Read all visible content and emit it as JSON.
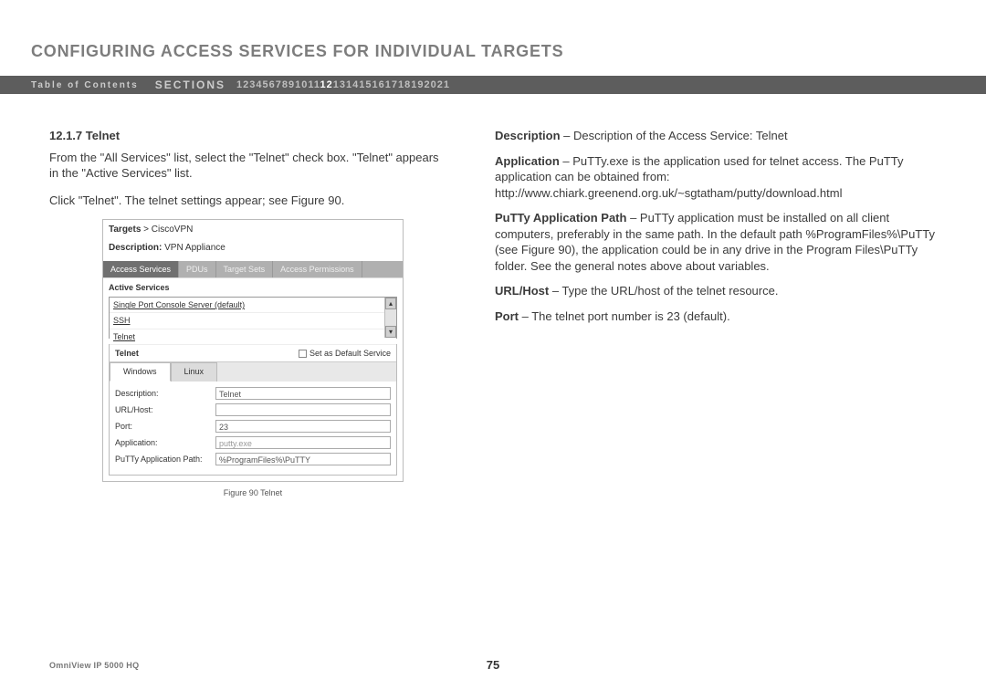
{
  "title": "CONFIGURING ACCESS SERVICES FOR INDIVIDUAL TARGETS",
  "nav": {
    "toc": "Table of Contents",
    "sections_label": "SECTIONS",
    "items": [
      "1",
      "2",
      "3",
      "4",
      "5",
      "6",
      "7",
      "8",
      "9",
      "10",
      "11",
      "12",
      "13",
      "14",
      "15",
      "16",
      "17",
      "18",
      "19",
      "20",
      "21"
    ],
    "active": "12"
  },
  "left": {
    "heading": "12.1.7 Telnet",
    "para1": "From the \"All Services\" list, select the \"Telnet\" check box. \"Telnet\" appears in the \"Active Services\" list.",
    "para2": "Click \"Telnet\". The telnet settings appear; see Figure 90."
  },
  "figure": {
    "breadcrumb_bold": "Targets",
    "breadcrumb_sep": " > ",
    "breadcrumb_tail": "CiscoVPN",
    "desc_label": "Description:",
    "desc_value": "VPN Appliance",
    "tabs": [
      "Access Services",
      "PDUs",
      "Target Sets",
      "Access Permissions"
    ],
    "active_tab": "Access Services",
    "active_services_label": "Active Services",
    "list": [
      "Single Port Console Server (default)",
      "SSH",
      "Telnet"
    ],
    "panel_name": "Telnet",
    "set_default": "Set as Default Service",
    "os_tabs": [
      "Windows",
      "Linux"
    ],
    "os_active": "Windows",
    "rows": [
      {
        "label": "Description:",
        "value": "Telnet",
        "gray": false
      },
      {
        "label": "URL/Host:",
        "value": "",
        "gray": false
      },
      {
        "label": "Port:",
        "value": "23",
        "gray": false
      },
      {
        "label": "Application:",
        "value": "putty.exe",
        "gray": true
      },
      {
        "label": "PuTTy Application Path:",
        "value": "%ProgramFiles%\\PuTTY",
        "gray": false
      }
    ],
    "caption": "Figure 90 Telnet"
  },
  "right": {
    "b1_lead": "Description",
    "b1_text": " – Description of the Access Service: Telnet",
    "b2_lead": "Application",
    "b2_text": " – PuTTy.exe is the application used for telnet access. The PuTTy application can be obtained from: http://www.chiark.greenend.org.uk/~sgtatham/putty/download.html",
    "b3_lead": "PuTTy Application Path",
    "b3_text": " – PuTTy application must be installed on all client computers, preferably in the same path. In the default path %ProgramFiles%\\PuTTy (see Figure 90), the application could be in any drive in the Program Files\\PuTTy folder. See the general notes above about variables.",
    "b4_lead": "URL/Host",
    "b4_text": " – Type the URL/host of the telnet resource.",
    "b5_lead": "Port",
    "b5_text": " – The telnet port number is 23 (default)."
  },
  "footer": {
    "product": "OmniView IP 5000 HQ",
    "page": "75"
  }
}
